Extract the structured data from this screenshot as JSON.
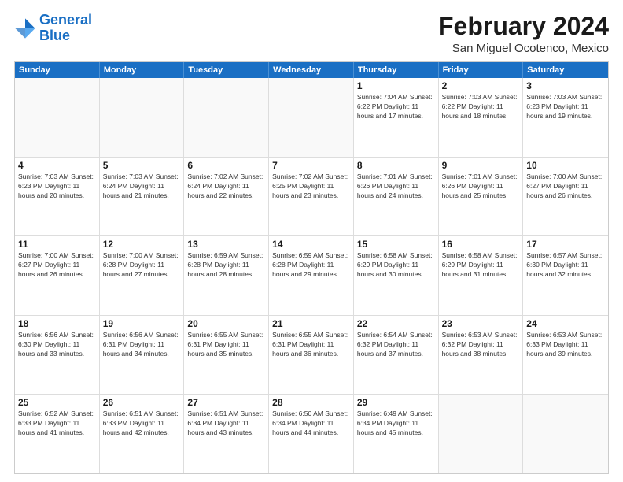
{
  "logo": {
    "line1": "General",
    "line2": "Blue"
  },
  "title": "February 2024",
  "subtitle": "San Miguel Ocotenco, Mexico",
  "weekdays": [
    "Sunday",
    "Monday",
    "Tuesday",
    "Wednesday",
    "Thursday",
    "Friday",
    "Saturday"
  ],
  "rows": [
    [
      {
        "day": "",
        "info": ""
      },
      {
        "day": "",
        "info": ""
      },
      {
        "day": "",
        "info": ""
      },
      {
        "day": "",
        "info": ""
      },
      {
        "day": "1",
        "info": "Sunrise: 7:04 AM\nSunset: 6:22 PM\nDaylight: 11 hours\nand 17 minutes."
      },
      {
        "day": "2",
        "info": "Sunrise: 7:03 AM\nSunset: 6:22 PM\nDaylight: 11 hours\nand 18 minutes."
      },
      {
        "day": "3",
        "info": "Sunrise: 7:03 AM\nSunset: 6:23 PM\nDaylight: 11 hours\nand 19 minutes."
      }
    ],
    [
      {
        "day": "4",
        "info": "Sunrise: 7:03 AM\nSunset: 6:23 PM\nDaylight: 11 hours\nand 20 minutes."
      },
      {
        "day": "5",
        "info": "Sunrise: 7:03 AM\nSunset: 6:24 PM\nDaylight: 11 hours\nand 21 minutes."
      },
      {
        "day": "6",
        "info": "Sunrise: 7:02 AM\nSunset: 6:24 PM\nDaylight: 11 hours\nand 22 minutes."
      },
      {
        "day": "7",
        "info": "Sunrise: 7:02 AM\nSunset: 6:25 PM\nDaylight: 11 hours\nand 23 minutes."
      },
      {
        "day": "8",
        "info": "Sunrise: 7:01 AM\nSunset: 6:26 PM\nDaylight: 11 hours\nand 24 minutes."
      },
      {
        "day": "9",
        "info": "Sunrise: 7:01 AM\nSunset: 6:26 PM\nDaylight: 11 hours\nand 25 minutes."
      },
      {
        "day": "10",
        "info": "Sunrise: 7:00 AM\nSunset: 6:27 PM\nDaylight: 11 hours\nand 26 minutes."
      }
    ],
    [
      {
        "day": "11",
        "info": "Sunrise: 7:00 AM\nSunset: 6:27 PM\nDaylight: 11 hours\nand 26 minutes."
      },
      {
        "day": "12",
        "info": "Sunrise: 7:00 AM\nSunset: 6:28 PM\nDaylight: 11 hours\nand 27 minutes."
      },
      {
        "day": "13",
        "info": "Sunrise: 6:59 AM\nSunset: 6:28 PM\nDaylight: 11 hours\nand 28 minutes."
      },
      {
        "day": "14",
        "info": "Sunrise: 6:59 AM\nSunset: 6:28 PM\nDaylight: 11 hours\nand 29 minutes."
      },
      {
        "day": "15",
        "info": "Sunrise: 6:58 AM\nSunset: 6:29 PM\nDaylight: 11 hours\nand 30 minutes."
      },
      {
        "day": "16",
        "info": "Sunrise: 6:58 AM\nSunset: 6:29 PM\nDaylight: 11 hours\nand 31 minutes."
      },
      {
        "day": "17",
        "info": "Sunrise: 6:57 AM\nSunset: 6:30 PM\nDaylight: 11 hours\nand 32 minutes."
      }
    ],
    [
      {
        "day": "18",
        "info": "Sunrise: 6:56 AM\nSunset: 6:30 PM\nDaylight: 11 hours\nand 33 minutes."
      },
      {
        "day": "19",
        "info": "Sunrise: 6:56 AM\nSunset: 6:31 PM\nDaylight: 11 hours\nand 34 minutes."
      },
      {
        "day": "20",
        "info": "Sunrise: 6:55 AM\nSunset: 6:31 PM\nDaylight: 11 hours\nand 35 minutes."
      },
      {
        "day": "21",
        "info": "Sunrise: 6:55 AM\nSunset: 6:31 PM\nDaylight: 11 hours\nand 36 minutes."
      },
      {
        "day": "22",
        "info": "Sunrise: 6:54 AM\nSunset: 6:32 PM\nDaylight: 11 hours\nand 37 minutes."
      },
      {
        "day": "23",
        "info": "Sunrise: 6:53 AM\nSunset: 6:32 PM\nDaylight: 11 hours\nand 38 minutes."
      },
      {
        "day": "24",
        "info": "Sunrise: 6:53 AM\nSunset: 6:33 PM\nDaylight: 11 hours\nand 39 minutes."
      }
    ],
    [
      {
        "day": "25",
        "info": "Sunrise: 6:52 AM\nSunset: 6:33 PM\nDaylight: 11 hours\nand 41 minutes."
      },
      {
        "day": "26",
        "info": "Sunrise: 6:51 AM\nSunset: 6:33 PM\nDaylight: 11 hours\nand 42 minutes."
      },
      {
        "day": "27",
        "info": "Sunrise: 6:51 AM\nSunset: 6:34 PM\nDaylight: 11 hours\nand 43 minutes."
      },
      {
        "day": "28",
        "info": "Sunrise: 6:50 AM\nSunset: 6:34 PM\nDaylight: 11 hours\nand 44 minutes."
      },
      {
        "day": "29",
        "info": "Sunrise: 6:49 AM\nSunset: 6:34 PM\nDaylight: 11 hours\nand 45 minutes."
      },
      {
        "day": "",
        "info": ""
      },
      {
        "day": "",
        "info": ""
      }
    ]
  ]
}
